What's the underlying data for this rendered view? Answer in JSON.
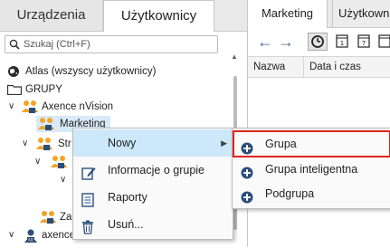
{
  "left_tabs": {
    "devices": "Urządzenia",
    "users": "Użytkownicy"
  },
  "search": {
    "placeholder": "Szukaj (Ctrl+F)"
  },
  "tree": {
    "atlas": "Atlas (wszyscy użytkownicy)",
    "groups": "GRUPY",
    "axence": "Axence nVision",
    "marketing": "Marketing",
    "str_partial": "Str",
    "za_partial": "Za",
    "axence_local_partial": "axence.local"
  },
  "right_tabs": {
    "marketing": "Marketing",
    "users_partial": "Użytkown"
  },
  "columns": {
    "name": "Nazwa",
    "datetime": "Data i czas"
  },
  "context_menu": {
    "new": "Nowy",
    "group_info": "Informacje o grupie",
    "reports": "Raporty",
    "delete": "Usuń..."
  },
  "submenu": {
    "group": "Grupa",
    "smart_group": "Grupa inteligentna",
    "subgroup": "Podgrupa"
  },
  "colors": {
    "accent": "#2b4f7c",
    "highlight_border": "#e0231c",
    "hover": "#cde8fb"
  }
}
